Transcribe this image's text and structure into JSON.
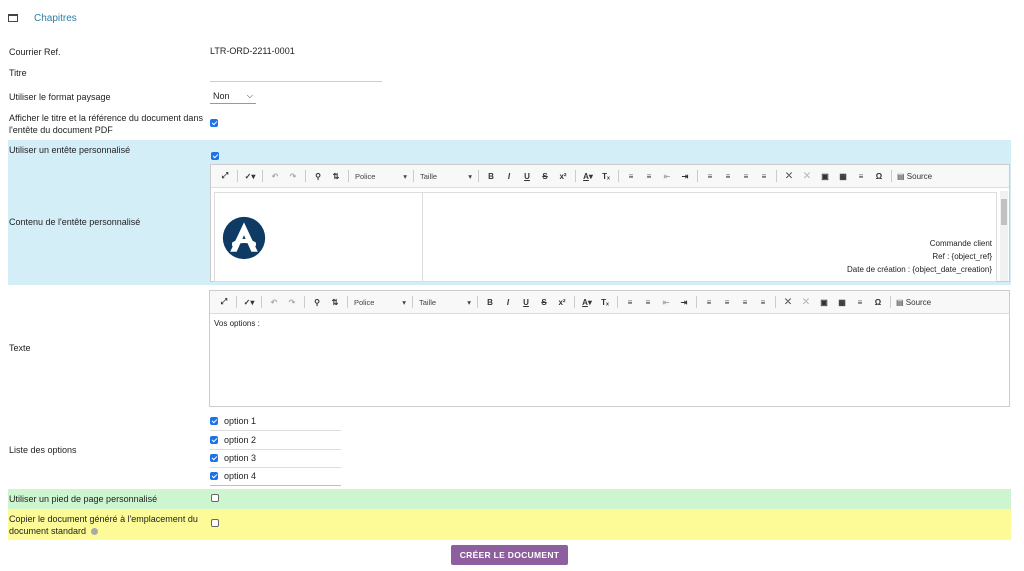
{
  "section": {
    "title": "Chapitres"
  },
  "fields": {
    "courrier_ref": {
      "label": "Courrier Ref.",
      "value": "LTR-ORD-2211-0001"
    },
    "titre": {
      "label": "Titre",
      "value": ""
    },
    "format_paysage": {
      "label": "Utiliser le format paysage",
      "value": "Non"
    },
    "afficher_titre": {
      "label": "Afficher le titre et la référence du document dans l'entête du document PDF",
      "checked": true
    },
    "entete_perso": {
      "label": "Utiliser un entête personnalisé",
      "checked": true
    },
    "contenu_entete": {
      "label": "Contenu de l'entête personnalisé"
    },
    "texte": {
      "label": "Texte"
    },
    "liste_options": {
      "label": "Liste des options"
    },
    "pied_page": {
      "label": "Utiliser un pied de page personnalisé",
      "checked": false
    },
    "copier_doc": {
      "label": "Copier le document généré à l'emplacement du document standard",
      "checked": false
    }
  },
  "toolbar": {
    "police": "Police",
    "taille": "Taille",
    "source": "Source"
  },
  "header_editor": {
    "lines": [
      "Commande client",
      "Ref : {object_ref}",
      "Date de création : {object_date_creation}"
    ]
  },
  "text_editor": {
    "content": "Vos options  :"
  },
  "options": [
    {
      "label": "option 1",
      "checked": true
    },
    {
      "label": "option 2",
      "checked": true
    },
    {
      "label": "option 3",
      "checked": true
    },
    {
      "label": "option 4",
      "checked": true
    }
  ],
  "button": {
    "label": "CRÉER LE DOCUMENT"
  },
  "colors": {
    "link": "#2a7ea8",
    "button": "#8e5f9e",
    "blue_row": "#d4eef7",
    "green_row": "#ccf5d0",
    "yellow_row": "#fcfb97",
    "logo": "#0f3a63"
  }
}
